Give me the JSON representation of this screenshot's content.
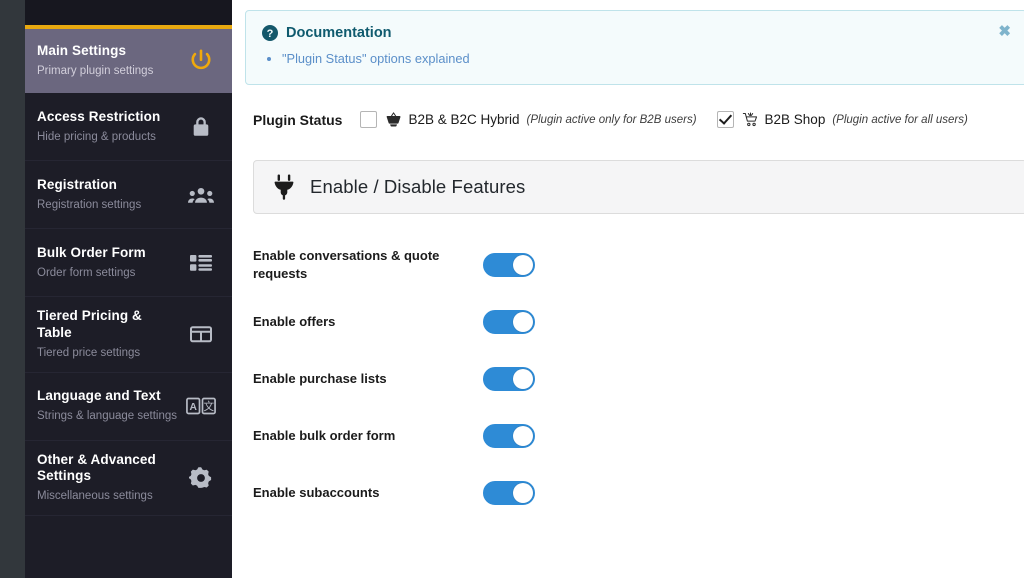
{
  "sidebar": {
    "items": [
      {
        "title": "Main Settings",
        "subtitle": "Primary plugin settings",
        "icon": "power-icon",
        "active": true
      },
      {
        "title": "Access Restriction",
        "subtitle": "Hide pricing & products",
        "icon": "lock-icon",
        "active": false
      },
      {
        "title": "Registration",
        "subtitle": "Registration settings",
        "icon": "users-icon",
        "active": false
      },
      {
        "title": "Bulk Order Form",
        "subtitle": "Order form settings",
        "icon": "list-icon",
        "active": false
      },
      {
        "title": "Tiered Pricing & Table",
        "subtitle": "Tiered price settings",
        "icon": "table-icon",
        "active": false
      },
      {
        "title": "Language and Text",
        "subtitle": "Strings & language settings",
        "icon": "translate-icon",
        "active": false
      },
      {
        "title": "Other & Advanced Settings",
        "subtitle": "Miscellaneous settings",
        "icon": "gear-icon",
        "active": false
      }
    ]
  },
  "notice": {
    "icon": "question-circle-icon",
    "title": "Documentation",
    "links": [
      "\"Plugin Status\" options explained"
    ],
    "close_label": "✖"
  },
  "plugin_status": {
    "label": "Plugin Status",
    "options": [
      {
        "icon": "shopping-basket-icon",
        "name": "B2B & B2C Hybrid",
        "hint": "(Plugin active only for B2B users)",
        "checked": false
      },
      {
        "icon": "shopping-cart-icon",
        "name": "B2B Shop",
        "hint": "(Plugin active for all users)",
        "checked": true
      }
    ]
  },
  "features_panel": {
    "icon": "plug-icon",
    "title": "Enable / Disable Features",
    "rows": [
      {
        "label": "Enable conversations & quote requests",
        "enabled": true
      },
      {
        "label": "Enable offers",
        "enabled": true
      },
      {
        "label": "Enable purchase lists",
        "enabled": true
      },
      {
        "label": "Enable bulk order form",
        "enabled": true
      },
      {
        "label": "Enable subaccounts",
        "enabled": true
      }
    ]
  },
  "colors": {
    "sidebar_bg": "#1d1d27",
    "sidebar_active_bg": "#6b677f",
    "accent_gold": "#e8a910",
    "toggle_on": "#2e8bd6",
    "notice_bg": "#f4fbfc",
    "notice_border": "#bfe3ea",
    "link_blue": "#5b8fc9",
    "wp_rail": "#32373c"
  }
}
